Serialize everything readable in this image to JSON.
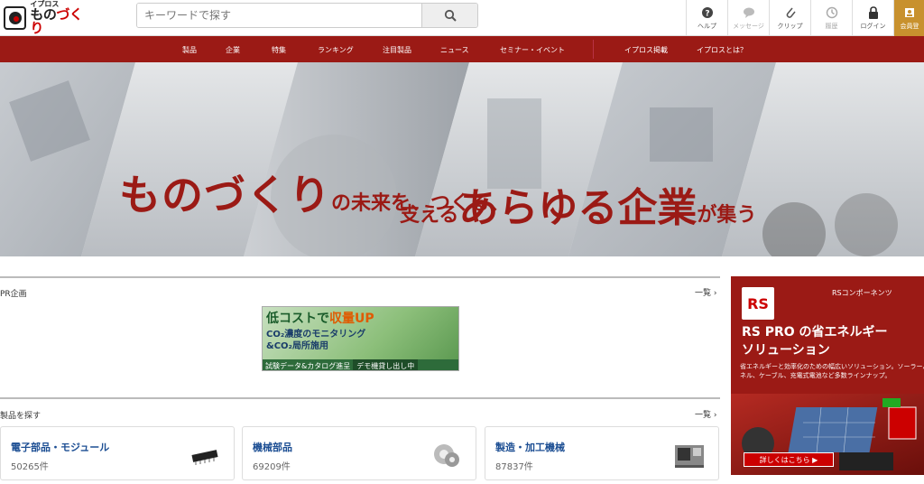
{
  "header": {
    "logo_small": "イプロス",
    "logo_main_a": "もの",
    "logo_main_b": "づくり",
    "search_placeholder": "キーワードで探す",
    "nav": [
      {
        "label": "ヘルプ",
        "icon": "help-icon"
      },
      {
        "label": "メッセージ",
        "icon": "message-icon"
      },
      {
        "label": "クリップ",
        "icon": "clip-icon"
      },
      {
        "label": "履歴",
        "icon": "history-icon"
      },
      {
        "label": "ログイン",
        "icon": "lock-icon"
      },
      {
        "label": "会員登",
        "icon": "member-icon"
      }
    ]
  },
  "redbar": {
    "links": [
      "製品",
      "企業",
      "特集",
      "ランキング",
      "注目製品",
      "ニュース",
      "セミナー・イベント",
      "イプロス掲載",
      "イプロスとは？"
    ]
  },
  "hero": {
    "line1_big": "ものづくり",
    "line1_small": "の未来を、つくる、",
    "line2_small_a": "支える",
    "line2_big": "あらゆる企業",
    "line2_small_b": "が集う"
  },
  "pr": {
    "label": "PR企画",
    "more": "一覧",
    "banner": {
      "title_a": "低コストで",
      "title_b": "収量UP",
      "sub1": "CO₂濃度のモニタリング",
      "sub2": "&CO₂局所施用",
      "pill1": "試験データ&カタログ進呈",
      "pill2": "デモ機貸し出し中"
    }
  },
  "products": {
    "label": "製品を探す",
    "more": "一覧",
    "cards": [
      {
        "name": "電子部品・モジュール",
        "count": "50265件"
      },
      {
        "name": "機械部品",
        "count": "69209件"
      },
      {
        "name": "製造・加工機械",
        "count": "87837件"
      }
    ]
  },
  "ad": {
    "logo": "RS",
    "company": "RSコンポーネンツ",
    "headline1": "RS PRO の省エネルギー",
    "headline2": "ソリューション",
    "desc": "省エネルギーと効率化のための幅広いソリューション。ソーラーパネル、ケーブル、充電式電池など多数ラインナップ。",
    "cta": "詳しくはこちら ▶"
  }
}
